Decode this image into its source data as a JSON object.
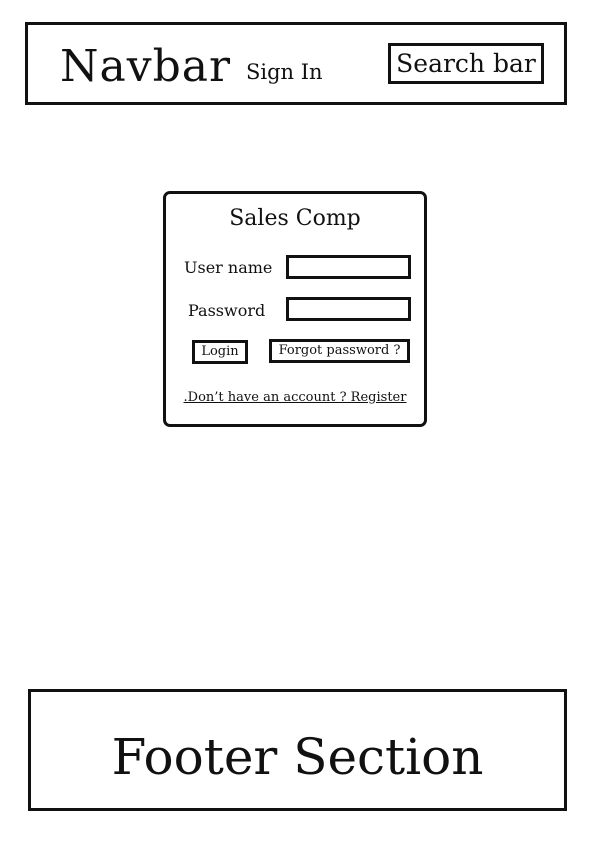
{
  "navbar": {
    "brand": "Navbar",
    "sign_in": "Sign In",
    "search": "Search bar"
  },
  "login": {
    "title": "Sales Comp",
    "username_label": "User name",
    "password_label": "Password",
    "login_button": "Login",
    "forgot_password": "Forgot password ?",
    "register_link": ".Don’t have an account ? Register"
  },
  "footer": {
    "title": "Footer Section"
  }
}
